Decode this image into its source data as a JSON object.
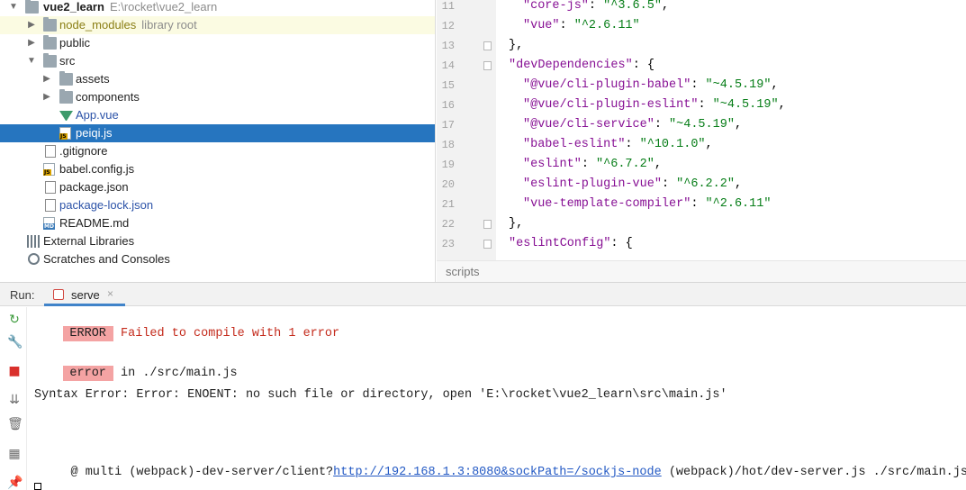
{
  "project": {
    "root": {
      "name": "vue2_learn",
      "path": "E:\\rocket\\vue2_learn"
    },
    "items": [
      {
        "label": "node_modules",
        "note": "library root",
        "icon": "folder-icon"
      },
      {
        "label": "public",
        "icon": "folder-icon"
      },
      {
        "label": "src",
        "icon": "folder-icon"
      },
      {
        "label": "assets",
        "icon": "folder-icon"
      },
      {
        "label": "components",
        "icon": "folder-icon"
      },
      {
        "label": "App.vue",
        "icon": "vue-file-icon"
      },
      {
        "label": "peiqi.js",
        "icon": "js-file-icon",
        "selected": true
      },
      {
        "label": ".gitignore",
        "icon": "git-file-icon"
      },
      {
        "label": "babel.config.js",
        "icon": "js-file-icon"
      },
      {
        "label": "package.json",
        "icon": "json-file-icon"
      },
      {
        "label": "package-lock.json",
        "icon": "json-file-icon"
      },
      {
        "label": "README.md",
        "icon": "markdown-file-icon"
      },
      {
        "label": "External Libraries",
        "icon": "library-icon"
      },
      {
        "label": "Scratches and Consoles",
        "icon": "scratch-icon"
      }
    ],
    "js_badge": "JS",
    "md_badge": "MD"
  },
  "editor": {
    "lines": [
      {
        "n": "11",
        "key": "\"core-js\"",
        "val": "\"^3.6.5\"",
        "tail": ","
      },
      {
        "n": "12",
        "key": "\"vue\"",
        "val": "\"^2.6.11\"",
        "tail": ""
      },
      {
        "n": "13",
        "plain": "},",
        "fold": true
      },
      {
        "n": "14",
        "key": "\"devDependencies\"",
        "tail": ": {",
        "fold": true
      },
      {
        "n": "15",
        "key": "\"@vue/cli-plugin-babel\"",
        "val": "\"~4.5.19\"",
        "tail": ","
      },
      {
        "n": "16",
        "key": "\"@vue/cli-plugin-eslint\"",
        "val": "\"~4.5.19\"",
        "tail": ","
      },
      {
        "n": "17",
        "key": "\"@vue/cli-service\"",
        "val": "\"~4.5.19\"",
        "tail": ","
      },
      {
        "n": "18",
        "key": "\"babel-eslint\"",
        "val": "\"^10.1.0\"",
        "tail": ","
      },
      {
        "n": "19",
        "key": "\"eslint\"",
        "val": "\"^6.7.2\"",
        "tail": ","
      },
      {
        "n": "20",
        "key": "\"eslint-plugin-vue\"",
        "val": "\"^6.2.2\"",
        "tail": ","
      },
      {
        "n": "21",
        "key": "\"vue-template-compiler\"",
        "val": "\"^2.6.11\"",
        "tail": ""
      },
      {
        "n": "22",
        "plain": "},",
        "fold": true
      },
      {
        "n": "23",
        "key": "\"eslintConfig\"",
        "tail": ": {",
        "fold": true
      }
    ],
    "breadcrumb": "scripts"
  },
  "run": {
    "label": "Run:",
    "tab": "serve",
    "tab_close": "×"
  },
  "console": {
    "error_tag": "ERROR",
    "error_msg": "Failed to compile with 1 error",
    "error_tag2": "error",
    "error_loc": " in ./src/main.js",
    "syntax": "Syntax Error: Error: ENOENT: no such file or directory, open 'E:\\rocket\\vue2_learn\\src\\main.js'",
    "multi_prefix": " @ multi (webpack)-dev-server/client?",
    "multi_link": "http://192.168.1.3:8080&sockPath=/sockjs-node",
    "multi_suffix": " (webpack)/hot/dev-server.js ./src/main.js"
  },
  "colors": {
    "selection": "#2675bf",
    "library_root_bg": "#fbfbe2",
    "error_tag_bg": "#f4a3a3",
    "error_text": "#c42b1c",
    "json_key": "#871094",
    "json_string": "#067d17",
    "link": "#2359c4"
  }
}
